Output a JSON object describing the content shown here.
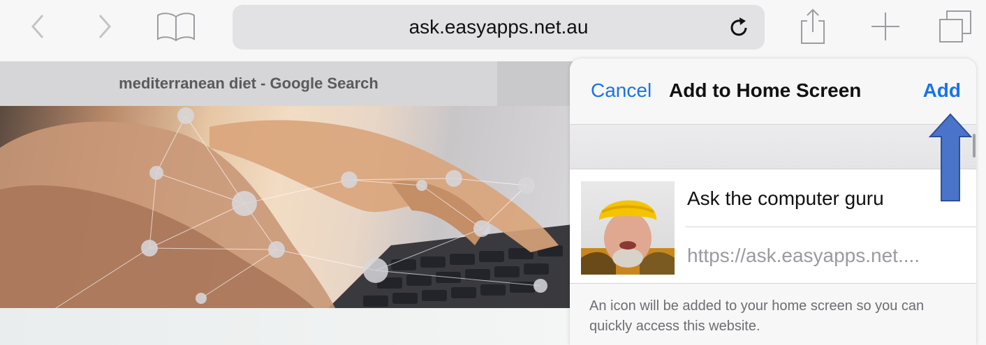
{
  "toolbar": {
    "address": "ask.easyapps.net.au",
    "back_icon": "chevron-left-icon",
    "forward_icon": "chevron-right-icon",
    "bookmarks_icon": "book-icon",
    "reload_icon": "reload-icon",
    "share_icon": "share-icon",
    "new_tab_icon": "plus-icon",
    "tabs_icon": "tabs-icon"
  },
  "tabs": [
    {
      "title": "mediterranean diet - Google Search",
      "active": true
    }
  ],
  "popover": {
    "cancel_label": "Cancel",
    "title": "Add to Home Screen",
    "add_label": "Add",
    "site_name": "Ask the computer guru",
    "site_url": "https://ask.easyapps.net....",
    "footer": "An icon will be added to your home screen so you can quickly access this website."
  },
  "colors": {
    "accent": "#1a73e8",
    "annotation_arrow": "#4a74c9"
  }
}
